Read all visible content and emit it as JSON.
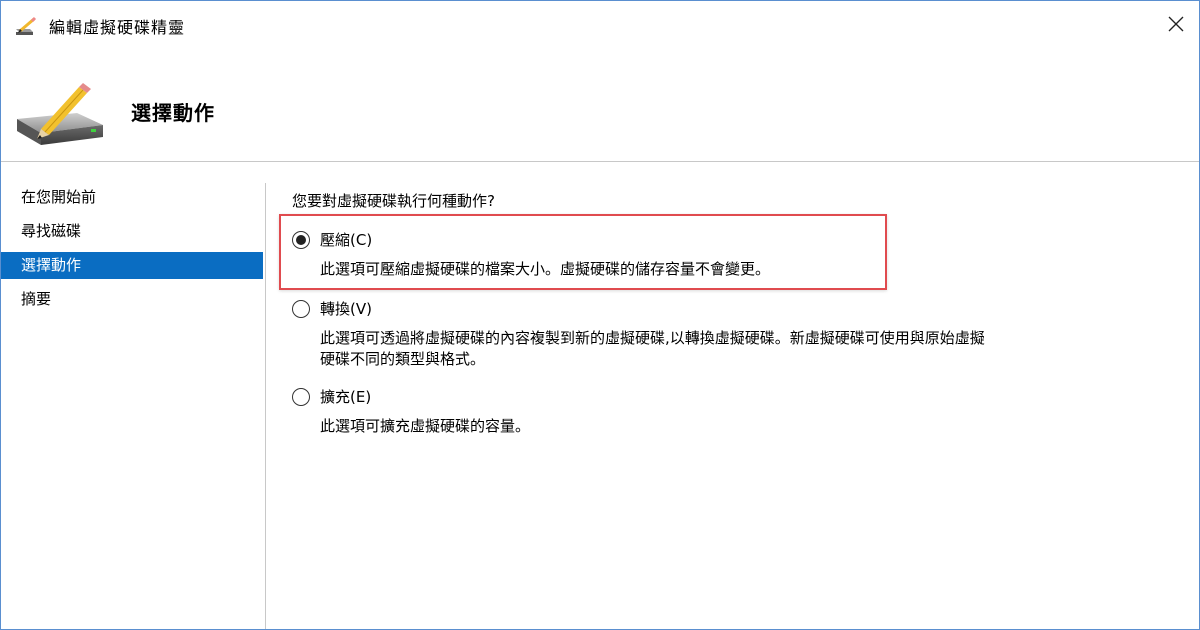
{
  "window": {
    "title": "編輯虛擬硬碟精靈",
    "close_label": "✕"
  },
  "header": {
    "title": "選擇動作"
  },
  "sidebar": {
    "items": [
      {
        "label": "在您開始前",
        "active": false
      },
      {
        "label": "尋找磁碟",
        "active": false
      },
      {
        "label": "選擇動作",
        "active": true
      },
      {
        "label": "摘要",
        "active": false
      }
    ]
  },
  "main": {
    "question": "您要對虛擬硬碟執行何種動作?",
    "options": [
      {
        "label": "壓縮(C)",
        "selected": true,
        "description": "此選項可壓縮虛擬硬碟的檔案大小。虛擬硬碟的儲存容量不會變更。"
      },
      {
        "label": "轉換(V)",
        "selected": false,
        "description_line1": "此選項可透過將虛擬硬碟的內容複製到新的虛擬硬碟,以轉換虛擬硬碟。新虛擬硬碟可使用與原始虛擬",
        "description_line2": "硬碟不同的類型與格式。"
      },
      {
        "label": "擴充(E)",
        "selected": false,
        "description": "此選項可擴充虛擬硬碟的容量。"
      }
    ]
  },
  "colors": {
    "accent": "#0a6dc2",
    "highlight_border": "#e04b4f"
  },
  "icons": [
    "wizard-disk-icon",
    "pencil-icon",
    "close-icon",
    "radio-icon"
  ]
}
